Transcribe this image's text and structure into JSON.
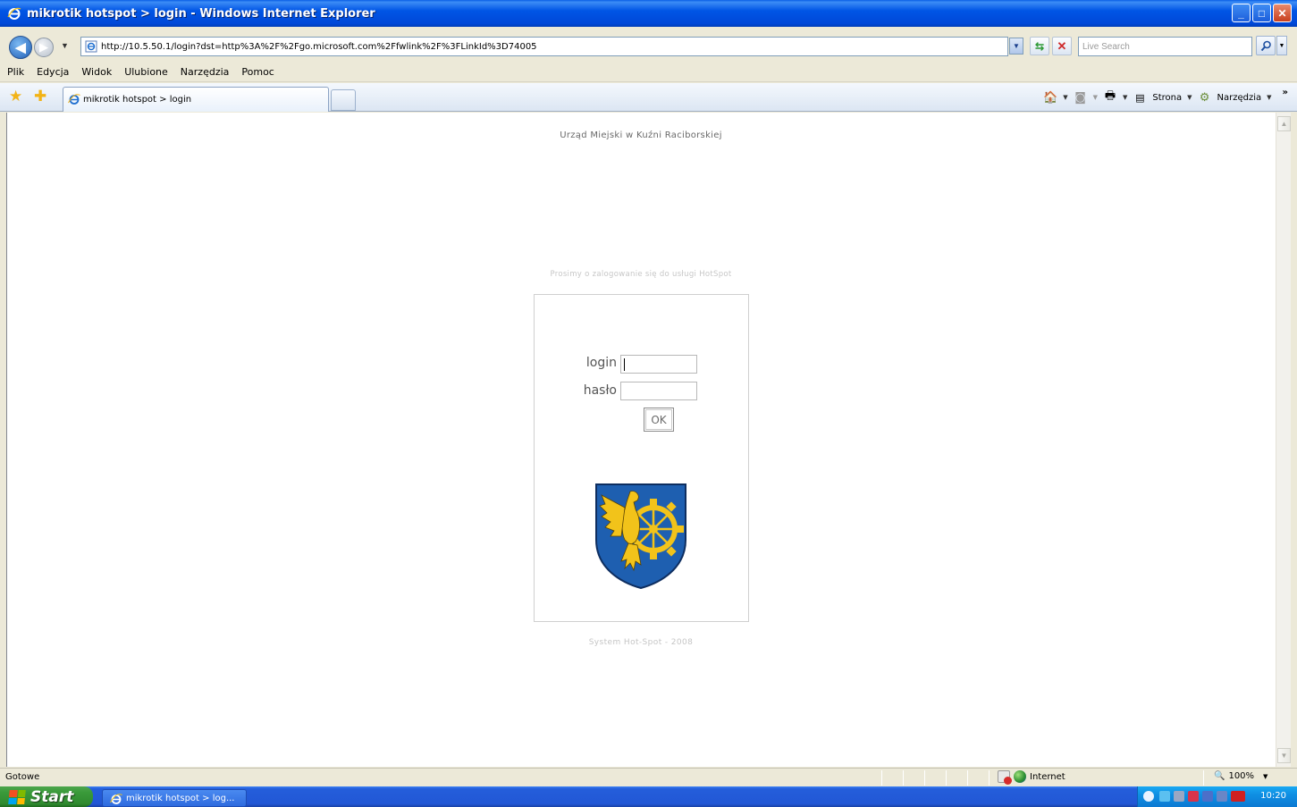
{
  "window": {
    "title": "mikrotik hotspot > login - Windows Internet Explorer",
    "minimize_label": "_",
    "maximize_label": "□",
    "close_label": "✕"
  },
  "addressbar": {
    "url": "http://10.5.50.1/login?dst=http%3A%2F%2Fgo.microsoft.com%2Ffwlink%2F%3FLinkId%3D74005",
    "search_placeholder": "Live Search"
  },
  "menu": {
    "items": [
      "Plik",
      "Edycja",
      "Widok",
      "Ulubione",
      "Narzędzia",
      "Pomoc"
    ]
  },
  "tabs": {
    "active_label": "mikrotik hotspot > login"
  },
  "commandbar": {
    "page_label": "Strona",
    "tools_label": "Narzędzia",
    "chevron": "»"
  },
  "page": {
    "org_name": "Urząd Miejski w Kuźni Raciborskiej",
    "prompt": "Prosimy o zalogowanie się do usługi HotSpot",
    "login_label": "login",
    "password_label": "hasło",
    "login_value": "",
    "password_value": "",
    "ok_label": "OK",
    "footer": "System Hot-Spot - 2008"
  },
  "statusbar": {
    "status_text": "Gotowe",
    "zone_label": "Internet",
    "zoom_label": "100%"
  },
  "taskbar": {
    "start_label": "Start",
    "task_label": "mikrotik hotspot > log...",
    "clock": "10:20"
  },
  "colors": {
    "titlebar": "#0055E5",
    "taskbar": "#245EDB",
    "start_button": "#3A9A3A",
    "crest_blue": "#1E5FB0",
    "crest_gold": "#F2C31A"
  }
}
